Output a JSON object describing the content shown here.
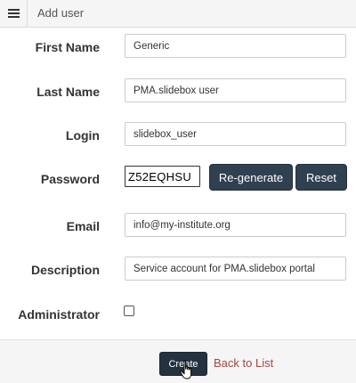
{
  "header": {
    "title": "Add user",
    "menu_icon": "hamburger-menu-icon"
  },
  "form": {
    "first_name": {
      "label": "First Name",
      "value": "Generic"
    },
    "last_name": {
      "label": "Last Name",
      "value": "PMA.slidebox user"
    },
    "login": {
      "label": "Login",
      "value": "slidebox_user"
    },
    "password": {
      "label": "Password",
      "value": "Z52EQHSU",
      "regenerate_label": "Re-generate",
      "reset_label": "Reset"
    },
    "email": {
      "label": "Email",
      "value": "info@my-institute.org"
    },
    "description": {
      "label": "Description",
      "value": "Service account for PMA.slidebox portal"
    },
    "administrator": {
      "label": "Administrator",
      "checked": false
    }
  },
  "footer": {
    "create_label": "Create",
    "back_label": "Back to List"
  },
  "colors": {
    "button_dark": "#2f4050",
    "link": "#a94442",
    "header_bg": "#f5f5f5"
  }
}
